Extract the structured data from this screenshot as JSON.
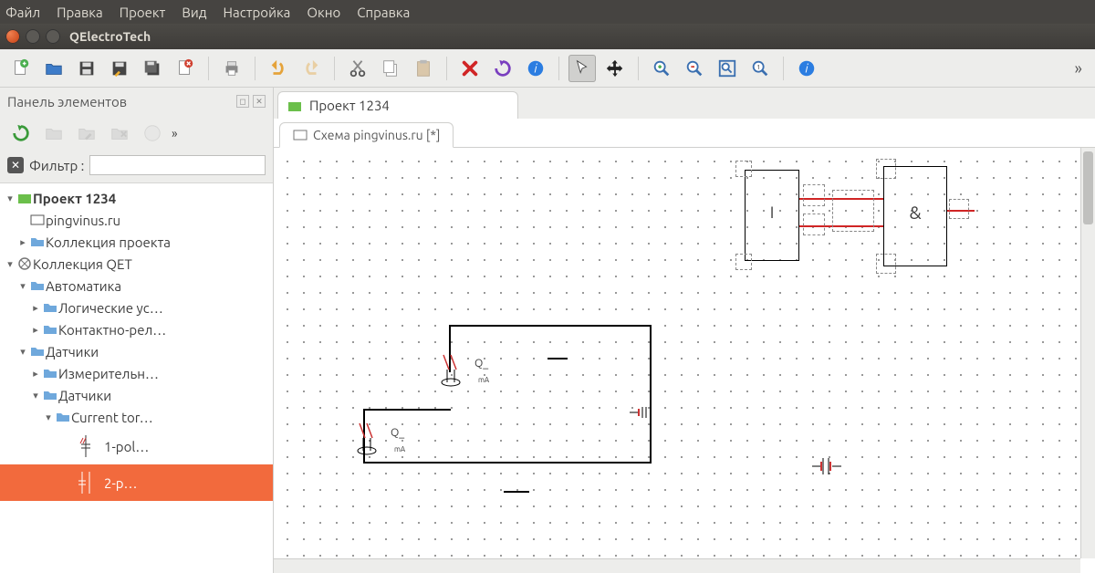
{
  "menu": {
    "file": "Файл",
    "edit": "Правка",
    "project": "Проект",
    "view": "Вид",
    "settings": "Настройка",
    "window": "Окно",
    "help": "Справка"
  },
  "app_title": "QElectroTech",
  "panel_title": "Панель элементов",
  "filter_label": "Фильтр :",
  "filter_value": "",
  "doc_tab": "Проект 1234",
  "sub_tab": "Схема pingvinus.ru [*]",
  "tree": {
    "n0": "Проект 1234",
    "n1": "pingvinus.ru",
    "n2": "Коллекция проекта",
    "n3": "Коллекция QET",
    "n4": "Автоматика",
    "n5": "Логические ус…",
    "n6": "Контактно-рел…",
    "n7": "Датчики",
    "n8": "Измерительн…",
    "n9": "Датчики",
    "n10": "Current tor…",
    "n11": "1-pol…",
    "n12": "2-p…"
  },
  "schem": {
    "gate1": "I",
    "gate2": "&",
    "q": "Q_",
    "ma": "mA"
  }
}
